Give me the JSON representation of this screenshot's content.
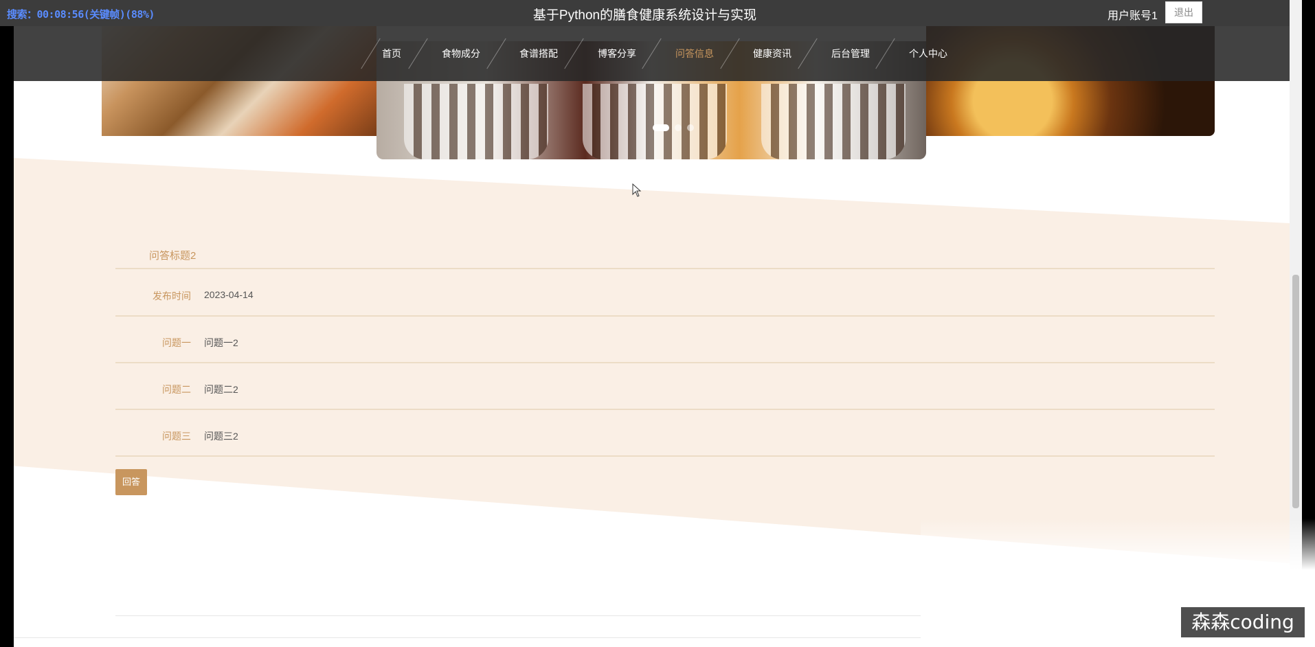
{
  "topbar": {
    "search_status": "搜索：00:08:56(关键帧)(88%)",
    "site_title": "基于Python的膳食健康系统设计与实现",
    "user_account": "用户账号1",
    "logout_label": "退出"
  },
  "nav": {
    "items": [
      {
        "label": "首页"
      },
      {
        "label": "食物成分"
      },
      {
        "label": "食谱搭配"
      },
      {
        "label": "博客分享"
      },
      {
        "label": "问答信息",
        "active": true
      },
      {
        "label": "健康资讯"
      },
      {
        "label": "后台管理"
      },
      {
        "label": "个人中心"
      }
    ]
  },
  "carousel": {
    "slides": 3,
    "active_index": 0
  },
  "detail": {
    "title": "问答标题2",
    "rows": [
      {
        "label": "发布时间",
        "value": "2023-04-14"
      },
      {
        "label": "问题一",
        "value": "问题一2"
      },
      {
        "label": "问题二",
        "value": "问题二2"
      },
      {
        "label": "问题三",
        "value": "问题三2"
      }
    ],
    "answer_button": "回答"
  },
  "watermark": "森森coding",
  "colors": {
    "accent": "#c8965e",
    "band": "#faefe5",
    "header": "#3c3c3c"
  }
}
